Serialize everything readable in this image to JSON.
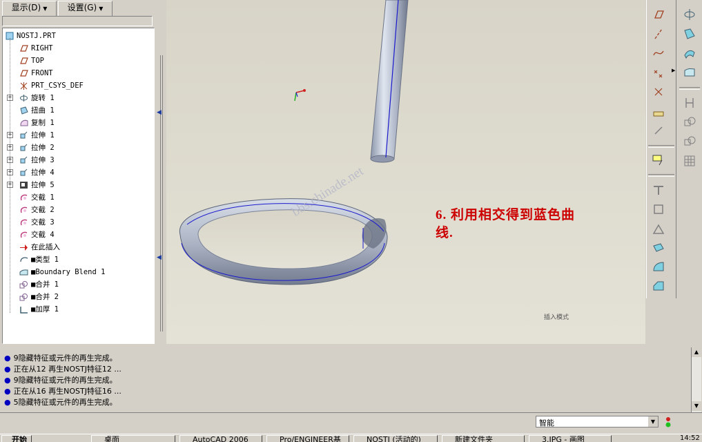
{
  "menu": {
    "display_label": "显示(D)",
    "settings_label": "设置(G)"
  },
  "tree": {
    "root": "NOSTJ.PRT",
    "items": [
      {
        "label": "RIGHT",
        "icon": "datum-plane-icon",
        "expand": false
      },
      {
        "label": "TOP",
        "icon": "datum-plane-icon",
        "expand": false
      },
      {
        "label": "FRONT",
        "icon": "datum-plane-icon",
        "expand": false
      },
      {
        "label": "PRT_CSYS_DEF",
        "icon": "csys-icon",
        "expand": false
      },
      {
        "label": "旋转 1",
        "icon": "revolve-icon",
        "expand": true
      },
      {
        "label": "扭曲 1",
        "icon": "warp-icon",
        "expand": false
      },
      {
        "label": "复制 1",
        "icon": "copy-icon",
        "expand": false
      },
      {
        "label": "拉伸 1",
        "icon": "extrude-icon",
        "expand": true
      },
      {
        "label": "拉伸 2",
        "icon": "extrude-icon",
        "expand": true
      },
      {
        "label": "拉伸 3",
        "icon": "extrude-icon",
        "expand": true
      },
      {
        "label": "拉伸 4",
        "icon": "extrude-icon",
        "expand": true
      },
      {
        "label": "拉伸 5",
        "icon": "extrude-cut-icon",
        "expand": true
      },
      {
        "label": "交截 1",
        "icon": "intersect-icon",
        "expand": false
      },
      {
        "label": "交截 2",
        "icon": "intersect-icon",
        "expand": false
      },
      {
        "label": "交截 3",
        "icon": "intersect-icon",
        "expand": false
      },
      {
        "label": "交截 4",
        "icon": "intersect-icon",
        "expand": false
      },
      {
        "label": "在此插入",
        "icon": "insert-here-arrow-icon",
        "expand": false
      },
      {
        "label": "■类型 1",
        "icon": "style-icon",
        "expand": false
      },
      {
        "label": "■Boundary Blend 1",
        "icon": "boundary-blend-icon",
        "expand": false
      },
      {
        "label": "■合并 1",
        "icon": "merge-icon",
        "expand": false
      },
      {
        "label": "■合并 2",
        "icon": "merge-icon",
        "expand": false
      },
      {
        "label": "■加厚 1",
        "icon": "thicken-icon",
        "expand": false
      }
    ]
  },
  "graphics": {
    "annotation_line1": "6. 利用相交得到蓝色曲",
    "annotation_line2": "线.",
    "watermark": "bbs.chinade.net",
    "mode_label": "插入模式",
    "annotation_color": "#cc0000",
    "curve_color": "#1a1acc"
  },
  "messages": [
    "9隐藏特征或元件的再生完成。",
    "正在从12 再生NOSTJ特征12 ...",
    "9隐藏特征或元件的再生完成。",
    "正在从16 再生NOSTJ特征16 ...",
    "5隐藏特征或元件的再生完成。"
  ],
  "filter": {
    "value": "智能"
  },
  "taskbar": {
    "start": "开始",
    "tasks": [
      "桌面",
      "AutoCAD 2006",
      "Pro/ENGINEER基",
      "NOSTJ (活动的)",
      "新建文件夹",
      "3.JPG - 画图"
    ],
    "clock": "14:52"
  }
}
